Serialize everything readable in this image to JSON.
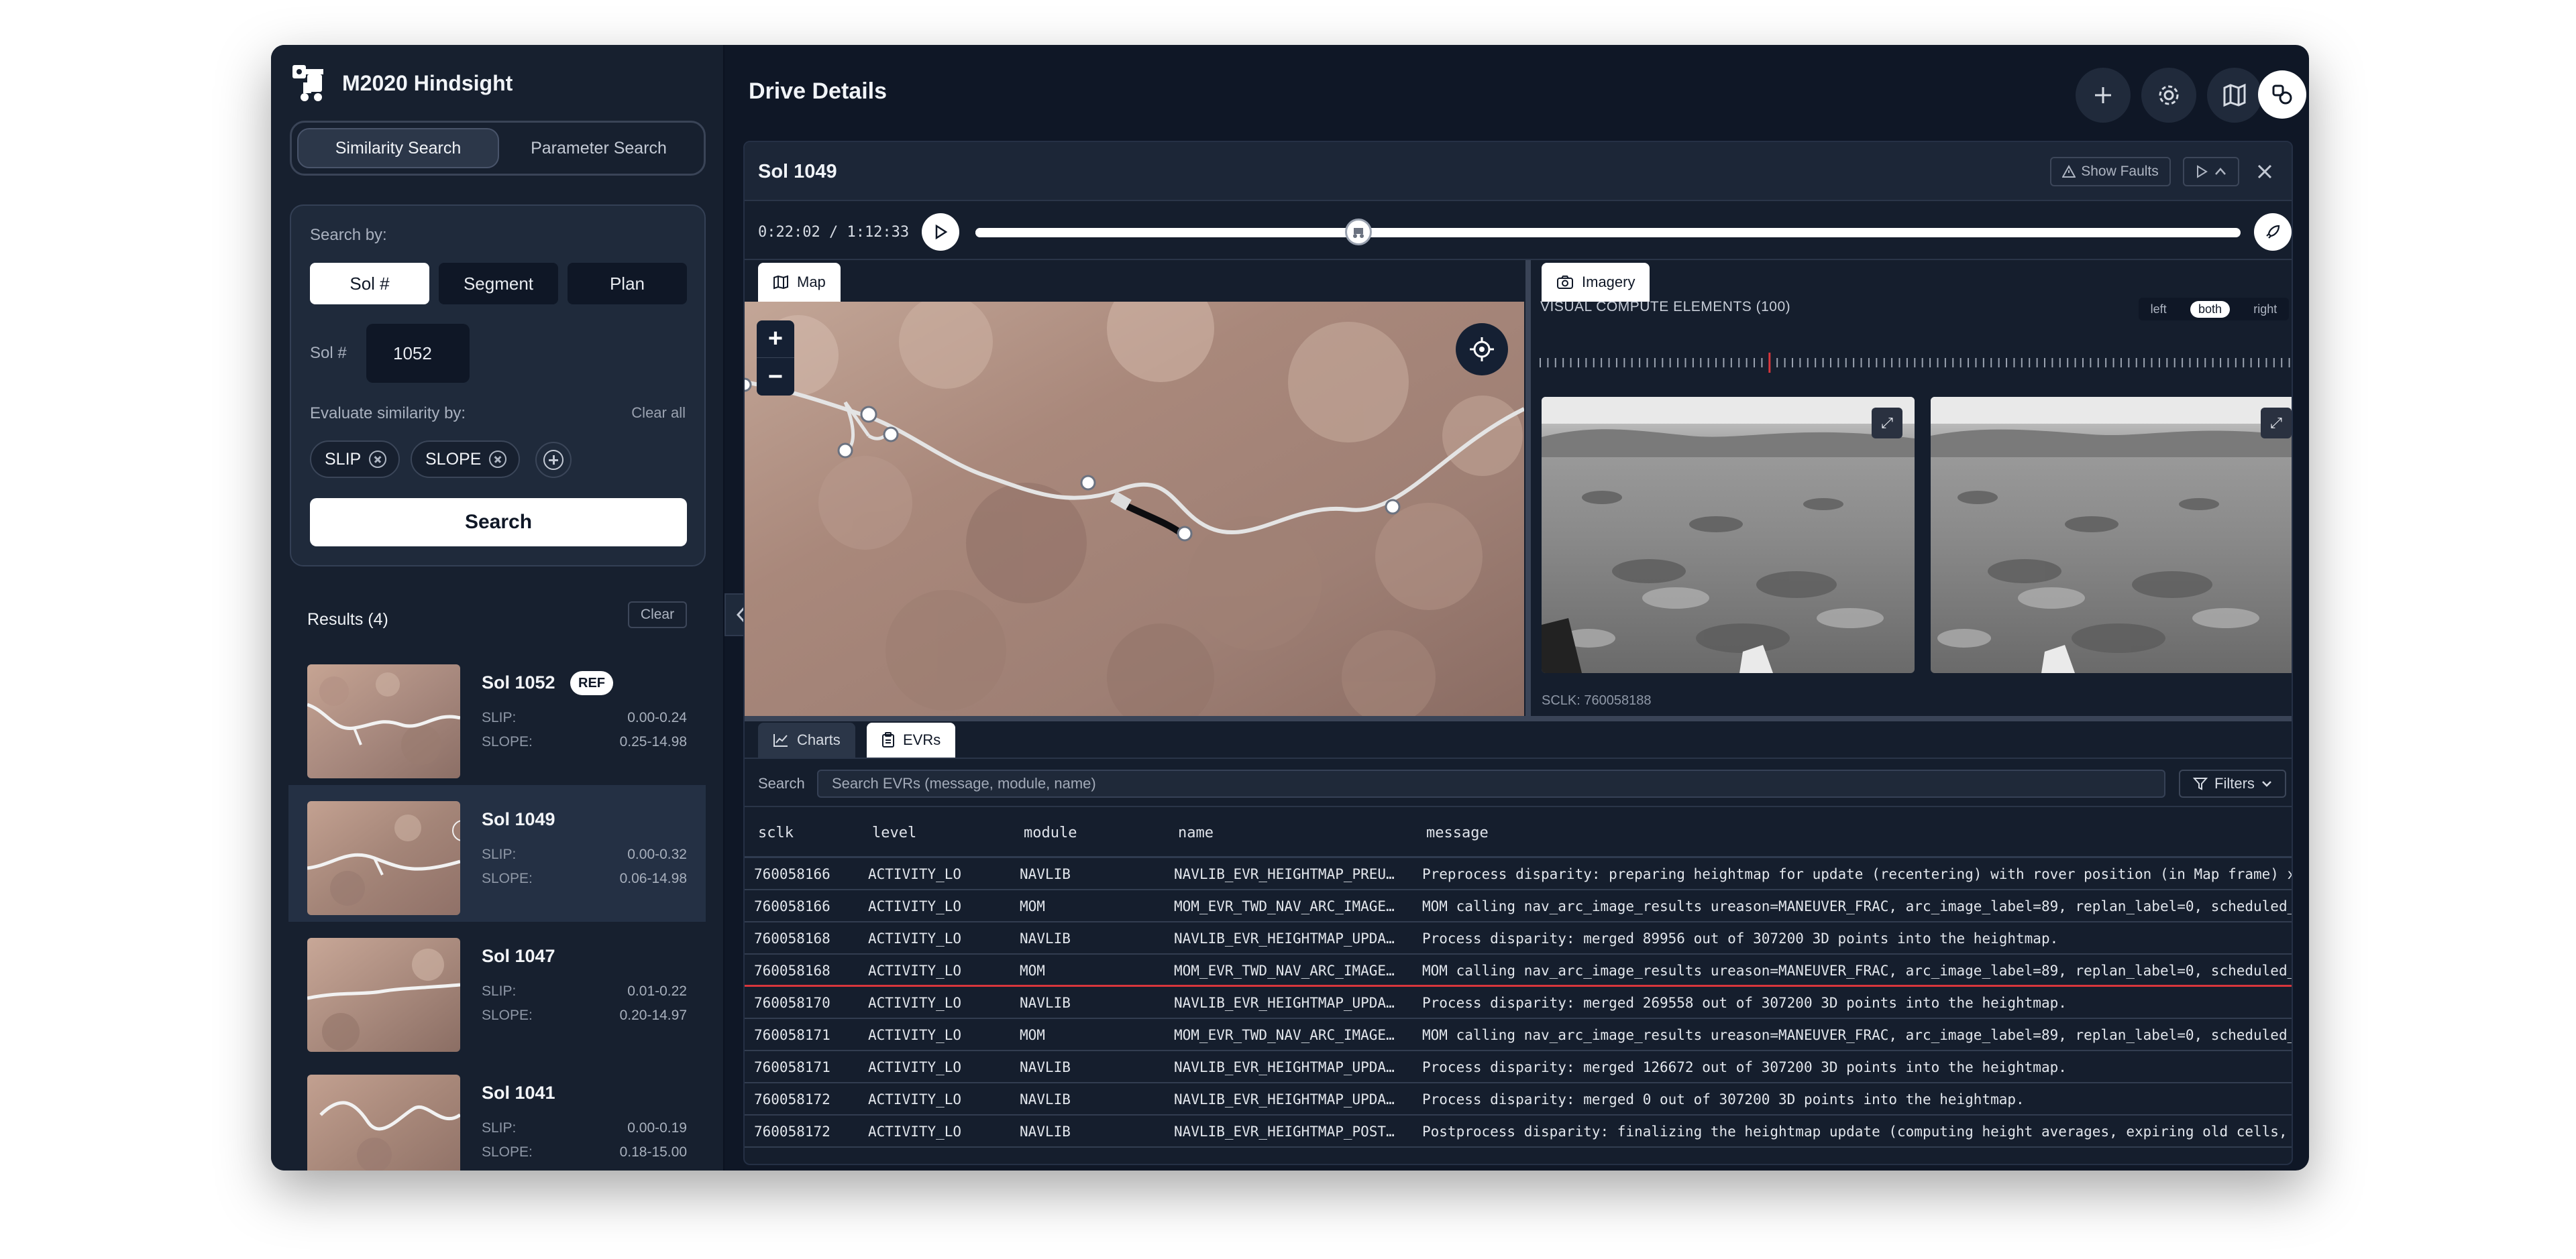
{
  "app": {
    "title": "M2020 Hindsight"
  },
  "sidebar": {
    "tabs": [
      {
        "label": "Similarity Search",
        "active": true
      },
      {
        "label": "Parameter Search",
        "active": false
      }
    ],
    "search_by_label": "Search by:",
    "search_by_options": [
      {
        "label": "Sol #",
        "selected": true
      },
      {
        "label": "Segment",
        "selected": false
      },
      {
        "label": "Plan",
        "selected": false
      }
    ],
    "sol_label": "Sol #",
    "sol_value": "1052",
    "evaluate_label": "Evaluate similarity by:",
    "clear_all": "Clear all",
    "chips": [
      "SLIP",
      "SLOPE"
    ],
    "search_button": "Search",
    "results_title": "Results (4)",
    "clear_button": "Clear",
    "results": [
      {
        "title": "Sol 1052",
        "badge": "REF",
        "slip_label": "SLIP:",
        "slip": "0.00-0.24",
        "slope_label": "SLOPE:",
        "slope": "0.25-14.98"
      },
      {
        "title": "Sol 1049",
        "badge": "",
        "slip_label": "SLIP:",
        "slip": "0.00-0.32",
        "slope_label": "SLOPE:",
        "slope": "0.06-14.98"
      },
      {
        "title": "Sol 1047",
        "badge": "",
        "slip_label": "SLIP:",
        "slip": "0.01-0.22",
        "slope_label": "SLOPE:",
        "slope": "0.20-14.97"
      },
      {
        "title": "Sol 1041",
        "badge": "",
        "slip_label": "SLIP:",
        "slip": "0.00-0.19",
        "slope_label": "SLOPE:",
        "slope": "0.18-15.00"
      }
    ]
  },
  "main": {
    "title": "Drive Details",
    "card": {
      "title": "Sol 1049",
      "show_faults": "Show Faults",
      "time": "0:22:02 / 1:12:33",
      "progress_fraction": 0.303,
      "tabs_top": {
        "map": "Map",
        "imagery": "Imagery"
      },
      "vce_title": "VISUAL COMPUTE ELEMENTS (100)",
      "view_options": [
        "left",
        "both",
        "right"
      ],
      "view_selected": "both",
      "sclk": "SCLK: 760058188",
      "tabs_bottom": {
        "charts": "Charts",
        "evrs": "EVRs"
      },
      "search_label": "Search",
      "search_placeholder": "Search EVRs (message, module, name)",
      "filters": "Filters",
      "columns": [
        "sclk",
        "level",
        "module",
        "name",
        "message"
      ],
      "rows": [
        {
          "sclk": "760058166",
          "level": "ACTIVITY_LO",
          "module": "NAVLIB",
          "name": "NAVLIB_EVR_HEIGHTMAP_PREU…",
          "message": "Preprocess disparity: preparing heightmap for update (recentering) with rover position (in Map frame) x"
        },
        {
          "sclk": "760058166",
          "level": "ACTIVITY_LO",
          "module": "MOM",
          "name": "MOM_EVR_TWD_NAV_ARC_IMAGE…",
          "message": "MOM calling nav_arc_image_results ureason=MANEUVER_FRAC, arc_image_label=89, replan_label=0, scheduled_"
        },
        {
          "sclk": "760058168",
          "level": "ACTIVITY_LO",
          "module": "NAVLIB",
          "name": "NAVLIB_EVR_HEIGHTMAP_UPDA…",
          "message": "Process disparity: merged 89956 out of 307200 3D points into the heightmap."
        },
        {
          "sclk": "760058168",
          "level": "ACTIVITY_LO",
          "module": "MOM",
          "name": "MOM_EVR_TWD_NAV_ARC_IMAGE…",
          "message": "MOM calling nav_arc_image_results ureason=MANEUVER_FRAC, arc_image_label=89, replan_label=0, scheduled_"
        },
        {
          "sclk": "760058170",
          "level": "ACTIVITY_LO",
          "module": "NAVLIB",
          "name": "NAVLIB_EVR_HEIGHTMAP_UPDA…",
          "message": "Process disparity: merged 269558 out of 307200 3D points into the heightmap."
        },
        {
          "sclk": "760058171",
          "level": "ACTIVITY_LO",
          "module": "MOM",
          "name": "MOM_EVR_TWD_NAV_ARC_IMAGE…",
          "message": "MOM calling nav_arc_image_results ureason=MANEUVER_FRAC, arc_image_label=89, replan_label=0, scheduled_"
        },
        {
          "sclk": "760058171",
          "level": "ACTIVITY_LO",
          "module": "NAVLIB",
          "name": "NAVLIB_EVR_HEIGHTMAP_UPDA…",
          "message": "Process disparity: merged 126672 out of 307200 3D points into the heightmap."
        },
        {
          "sclk": "760058172",
          "level": "ACTIVITY_LO",
          "module": "NAVLIB",
          "name": "NAVLIB_EVR_HEIGHTMAP_UPDA…",
          "message": "Process disparity: merged 0 out of 307200 3D points into the heightmap."
        },
        {
          "sclk": "760058172",
          "level": "ACTIVITY_LO",
          "module": "NAVLIB",
          "name": "NAVLIB_EVR_HEIGHTMAP_POST…",
          "message": "Postprocess disparity: finalizing the heightmap update (computing height averages, expiring old cells,"
        }
      ]
    }
  },
  "icons": [
    "rover-logo-icon",
    "plus-icon",
    "gear-icon",
    "map-icon",
    "layers-icon",
    "warning-icon",
    "play-icon",
    "chevron-up-icon",
    "close-icon",
    "rocket-icon",
    "camera-icon",
    "chart-icon",
    "clipboard-icon",
    "filter-icon",
    "chevron-down-icon",
    "crosshair-icon",
    "expand-icon",
    "chevron-left-icon",
    "check-circle-icon"
  ],
  "colors": {
    "app_bg": "#0f1726",
    "sidebar_bg": "#17202f",
    "accent_white": "#ffffff",
    "highlight_row": "#d8363c"
  }
}
